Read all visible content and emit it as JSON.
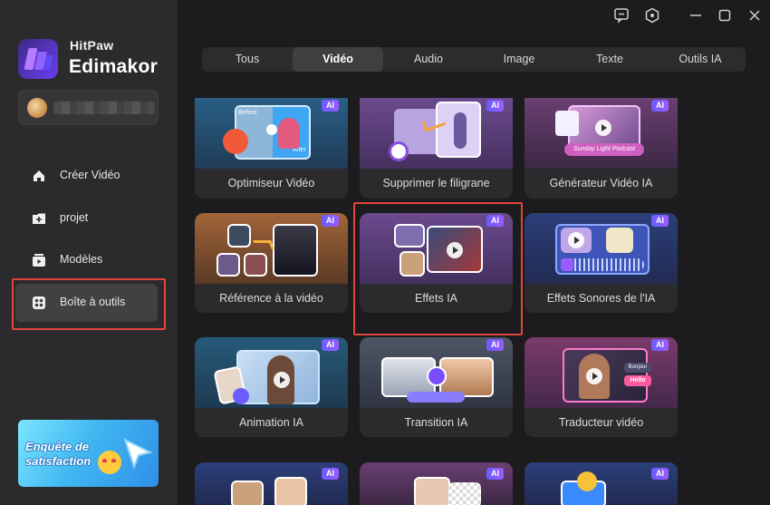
{
  "app": {
    "brand_small": "HitPaw",
    "brand_big": "Edimakor"
  },
  "sidebar": {
    "items": [
      {
        "label": "Créer Vidéo",
        "icon": "home-icon"
      },
      {
        "label": "projet",
        "icon": "folder-icon"
      },
      {
        "label": "Modèles",
        "icon": "templates-icon"
      },
      {
        "label": "Boîte à outils",
        "icon": "toolbox-icon",
        "active": true
      }
    ],
    "survey_label": "Enquête de satisfaction"
  },
  "tabs": [
    {
      "label": "Tous"
    },
    {
      "label": "Vidéo",
      "active": true
    },
    {
      "label": "Audio"
    },
    {
      "label": "Image"
    },
    {
      "label": "Texte"
    },
    {
      "label": "Outils IA"
    }
  ],
  "badge": "AI",
  "cards": [
    {
      "title": "Optimiseur Vidéo",
      "before": "Before",
      "after": "After"
    },
    {
      "title": "Supprimer le filigrane"
    },
    {
      "title": "Générateur Vidéo IA",
      "podcast": "Sunday Light Podcast"
    },
    {
      "title": "Référence à la vidéo"
    },
    {
      "title": "Effets IA"
    },
    {
      "title": "Effets Sonores de l'IA"
    },
    {
      "title": "Animation IA"
    },
    {
      "title": "Transition IA"
    },
    {
      "title": "Traducteur vidéo",
      "words": [
        "Bonjour",
        "Hello"
      ]
    }
  ],
  "colors": {
    "accent": "#6a5cff",
    "highlight": "#e0463a",
    "background": "#1c1c1e",
    "sidebar": "#2b2b2d"
  }
}
